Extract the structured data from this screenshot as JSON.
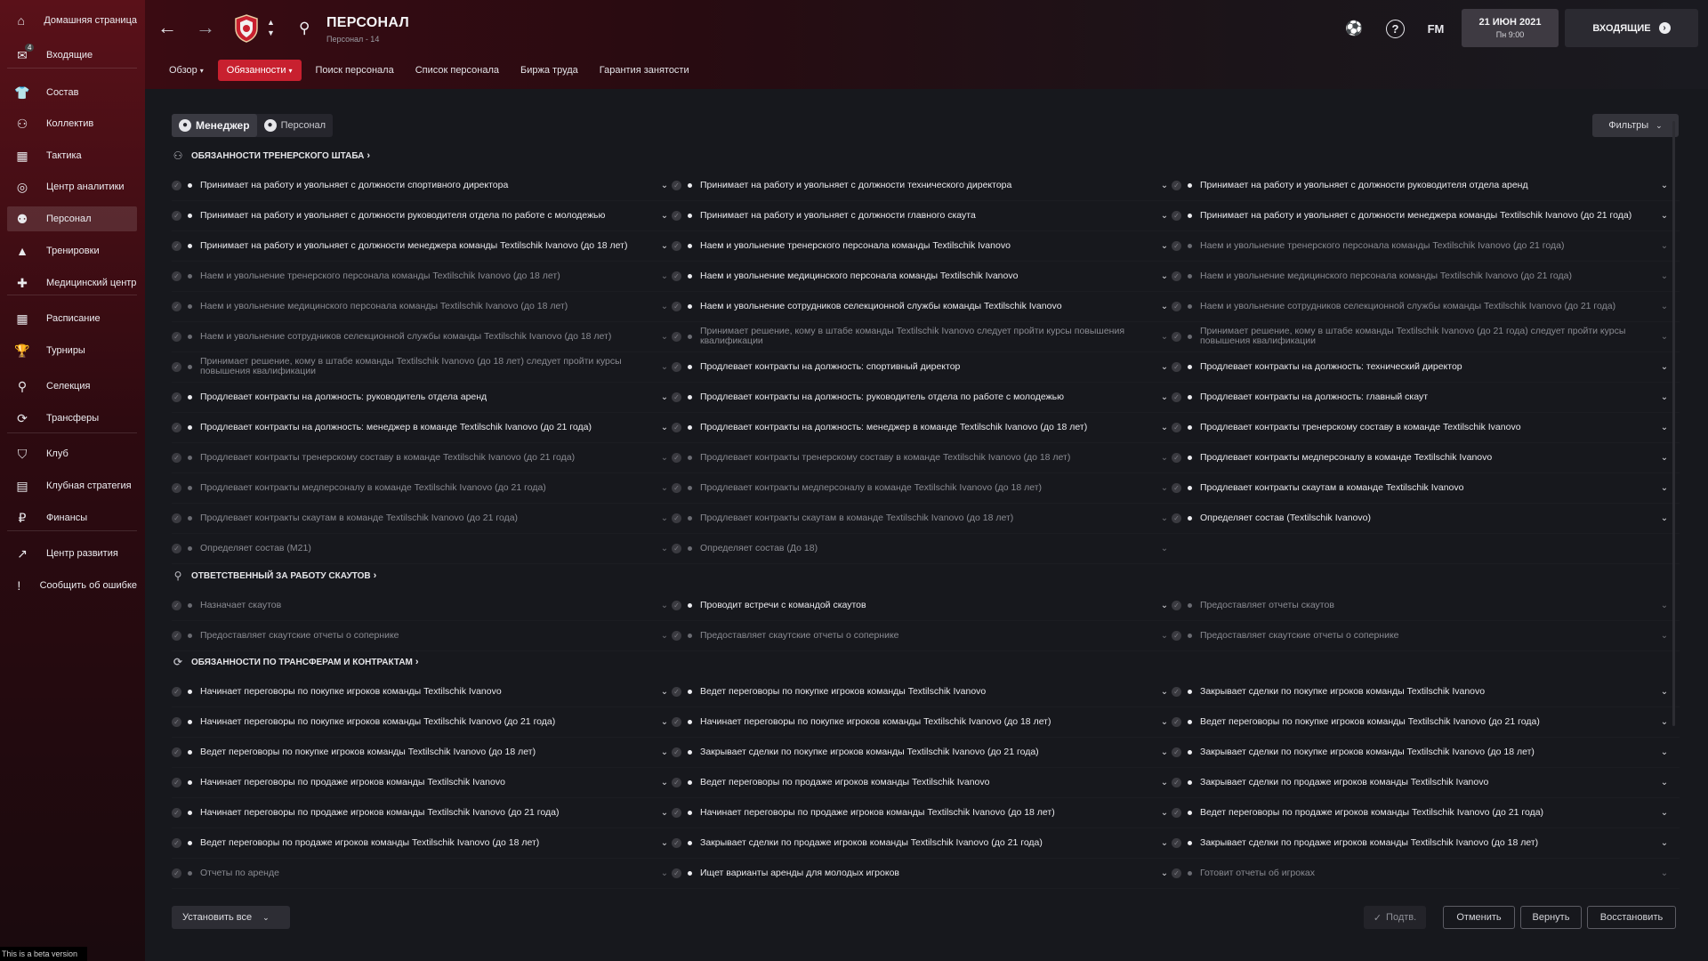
{
  "sidebar": {
    "inbox_badge": "4",
    "items": [
      {
        "label": "Домашняя страница",
        "icon": "home-icon"
      },
      {
        "label": "Входящие",
        "icon": "inbox-icon"
      },
      {
        "label": "Состав",
        "icon": "squad-icon"
      },
      {
        "label": "Коллектив",
        "icon": "dynamics-icon"
      },
      {
        "label": "Тактика",
        "icon": "tactics-icon"
      },
      {
        "label": "Центр аналитики",
        "icon": "analytics-icon"
      },
      {
        "label": "Персонал",
        "icon": "staff-icon"
      },
      {
        "label": "Тренировки",
        "icon": "training-icon"
      },
      {
        "label": "Медицинский центр",
        "icon": "medical-icon"
      },
      {
        "label": "Расписание",
        "icon": "calendar-icon"
      },
      {
        "label": "Турниры",
        "icon": "trophy-icon"
      },
      {
        "label": "Селекция",
        "icon": "scouting-icon"
      },
      {
        "label": "Трансферы",
        "icon": "transfers-icon"
      },
      {
        "label": "Клуб",
        "icon": "club-icon"
      },
      {
        "label": "Клубная стратегия",
        "icon": "strategy-icon"
      },
      {
        "label": "Финансы",
        "icon": "finances-icon"
      },
      {
        "label": "Центр развития",
        "icon": "development-icon"
      },
      {
        "label": "Сообщить об ошибке",
        "icon": "bug-report-icon"
      }
    ],
    "beta_label": "This is a beta version"
  },
  "header": {
    "title": "ПЕРСОНАЛ",
    "subtitle": "Персонал - 14",
    "tabs": [
      {
        "label": "Обзор",
        "dropdown": true
      },
      {
        "label": "Обязанности",
        "dropdown": true,
        "active": true
      },
      {
        "label": "Поиск персонала"
      },
      {
        "label": "Список персонала"
      },
      {
        "label": "Биржа труда"
      },
      {
        "label": "Гарантия занятости"
      }
    ],
    "fm_label": "FM",
    "help_label": "?",
    "date": "21 ИЮН 2021",
    "day_time": "Пн 9:00",
    "inbox_label": "ВХОДЯЩИЕ"
  },
  "toolbar": {
    "manager_label": "Менеджер",
    "staff_label": "Персонал",
    "filters_label": "Фильтры"
  },
  "sections": [
    {
      "title": "ОБЯЗАННОСТИ ТРЕНЕРСКОГО ШТАБА",
      "icon": "coaching-staff-icon",
      "rows": [
        [
          {
            "t": "Принимает на работу и увольняет с должности спортивного директора",
            "a": true
          },
          {
            "t": "Принимает на работу и увольняет с должности технического директора",
            "a": true
          },
          {
            "t": "Принимает на работу и увольняет с должности руководителя отдела аренд",
            "a": true
          }
        ],
        [
          {
            "t": "Принимает на работу и увольняет с должности руководителя отдела по работе с молодежью",
            "a": true
          },
          {
            "t": "Принимает на работу и увольняет с должности главного скаута",
            "a": true
          },
          {
            "t": "Принимает на работу и увольняет с должности менеджера команды Textilschik Ivanovo (до 21 года)",
            "a": true
          }
        ],
        [
          {
            "t": "Принимает на работу и увольняет с должности менеджера команды Textilschik Ivanovo (до 18 лет)",
            "a": true
          },
          {
            "t": "Наем и увольнение тренерского персонала команды Textilschik Ivanovo",
            "a": true
          },
          {
            "t": "Наем и увольнение тренерского персонала команды Textilschik Ivanovo (до 21 года)",
            "a": false
          }
        ],
        [
          {
            "t": "Наем и увольнение тренерского персонала команды Textilschik Ivanovo (до 18 лет)",
            "a": false
          },
          {
            "t": "Наем и увольнение медицинского персонала команды Textilschik Ivanovo",
            "a": true
          },
          {
            "t": "Наем и увольнение медицинского персонала команды Textilschik Ivanovo (до 21 года)",
            "a": false
          }
        ],
        [
          {
            "t": "Наем и увольнение медицинского персонала команды Textilschik Ivanovo (до 18 лет)",
            "a": false
          },
          {
            "t": "Наем и увольнение сотрудников селекционной службы команды Textilschik Ivanovo",
            "a": true
          },
          {
            "t": "Наем и увольнение сотрудников селекционной службы команды Textilschik Ivanovo (до 21 года)",
            "a": false
          }
        ],
        [
          {
            "t": "Наем и увольнение сотрудников селекционной службы команды Textilschik Ivanovo (до 18 лет)",
            "a": false
          },
          {
            "t": "Принимает решение, кому в штабе команды Textilschik Ivanovo следует пройти курсы повышения квалификации",
            "a": false
          },
          {
            "t": "Принимает решение, кому в штабе команды Textilschik Ivanovo (до 21 года) следует пройти курсы повышения квалификации",
            "a": false
          }
        ],
        [
          {
            "t": "Принимает решение, кому в штабе команды Textilschik Ivanovo (до 18 лет) следует пройти курсы повышения квалификации",
            "a": false
          },
          {
            "t": "Продлевает контракты на должность: спортивный директор",
            "a": true
          },
          {
            "t": "Продлевает контракты на должность: технический директор",
            "a": true
          }
        ],
        [
          {
            "t": "Продлевает контракты на должность: руководитель отдела аренд",
            "a": true
          },
          {
            "t": "Продлевает контракты на должность: руководитель отдела по работе с молодежью",
            "a": true
          },
          {
            "t": "Продлевает контракты на должность: главный скаут",
            "a": true
          }
        ],
        [
          {
            "t": "Продлевает контракты на должность: менеджер в команде Textilschik Ivanovo (до 21 года)",
            "a": true
          },
          {
            "t": "Продлевает контракты на должность: менеджер в команде Textilschik Ivanovo (до 18 лет)",
            "a": true
          },
          {
            "t": "Продлевает контракты тренерскому составу в команде Textilschik Ivanovo",
            "a": true
          }
        ],
        [
          {
            "t": "Продлевает контракты тренерскому составу в команде Textilschik Ivanovo (до 21 года)",
            "a": false
          },
          {
            "t": "Продлевает контракты тренерскому составу в команде Textilschik Ivanovo (до 18 лет)",
            "a": false
          },
          {
            "t": "Продлевает контракты медперсоналу в команде Textilschik Ivanovo",
            "a": true
          }
        ],
        [
          {
            "t": "Продлевает контракты медперсоналу в команде Textilschik Ivanovo (до 21 года)",
            "a": false
          },
          {
            "t": "Продлевает контракты медперсоналу в команде Textilschik Ivanovo (до 18 лет)",
            "a": false
          },
          {
            "t": "Продлевает контракты скаутам в команде Textilschik Ivanovo",
            "a": true
          }
        ],
        [
          {
            "t": "Продлевает контракты скаутам в команде Textilschik Ivanovo (до 21 года)",
            "a": false
          },
          {
            "t": "Продлевает контракты скаутам в команде Textilschik Ivanovo (до 18 лет)",
            "a": false
          },
          {
            "t": "Определяет состав (Textilschik Ivanovo)",
            "a": true
          }
        ],
        [
          {
            "t": "Определяет состав (M21)",
            "a": false
          },
          {
            "t": "Определяет состав (До 18)",
            "a": false
          },
          null
        ]
      ]
    },
    {
      "title": "ОТВЕТСТВЕННЫЙ ЗА РАБОТУ СКАУТОВ",
      "icon": "scout-search-icon",
      "rows": [
        [
          {
            "t": "Назначает скаутов",
            "a": false
          },
          {
            "t": "Проводит встречи с командой скаутов",
            "a": true
          },
          {
            "t": "Предоставляет отчеты скаутов",
            "a": false
          }
        ],
        [
          {
            "t": "Предоставляет скаутские отчеты о сопернике",
            "a": false
          },
          {
            "t": "Предоставляет скаутские отчеты о сопернике",
            "a": false
          },
          {
            "t": "Предоставляет скаутские отчеты о сопернике",
            "a": false
          }
        ]
      ]
    },
    {
      "title": "ОБЯЗАННОСТИ ПО ТРАНСФЕРАМ И КОНТРАКТАМ",
      "icon": "transfer-contract-icon",
      "rows": [
        [
          {
            "t": "Начинает переговоры по покупке игроков команды Textilschik Ivanovo",
            "a": true
          },
          {
            "t": "Ведет переговоры по покупке игроков команды Textilschik Ivanovo",
            "a": true
          },
          {
            "t": "Закрывает сделки по покупке игроков команды Textilschik Ivanovo",
            "a": true
          }
        ],
        [
          {
            "t": "Начинает переговоры по покупке игроков команды Textilschik Ivanovo (до 21 года)",
            "a": true
          },
          {
            "t": "Начинает переговоры по покупке игроков команды Textilschik Ivanovo (до 18 лет)",
            "a": true
          },
          {
            "t": "Ведет переговоры по покупке игроков команды Textilschik Ivanovo (до 21 года)",
            "a": true
          }
        ],
        [
          {
            "t": "Ведет переговоры по покупке игроков команды Textilschik Ivanovo (до 18 лет)",
            "a": true
          },
          {
            "t": "Закрывает сделки по покупке игроков команды Textilschik Ivanovo (до 21 года)",
            "a": true
          },
          {
            "t": "Закрывает сделки по покупке игроков команды Textilschik Ivanovo (до 18 лет)",
            "a": true
          }
        ],
        [
          {
            "t": "Начинает переговоры по продаже игроков команды Textilschik Ivanovo",
            "a": true
          },
          {
            "t": "Ведет переговоры по продаже игроков команды Textilschik Ivanovo",
            "a": true
          },
          {
            "t": "Закрывает сделки по продаже игроков команды Textilschik Ivanovo",
            "a": true
          }
        ],
        [
          {
            "t": "Начинает переговоры по продаже игроков команды Textilschik Ivanovo (до 21 года)",
            "a": true
          },
          {
            "t": "Начинает переговоры по продаже игроков команды Textilschik Ivanovo (до 18 лет)",
            "a": true
          },
          {
            "t": "Ведет переговоры по продаже игроков команды Textilschik Ivanovo (до 21 года)",
            "a": true
          }
        ],
        [
          {
            "t": "Ведет переговоры по продаже игроков команды Textilschik Ivanovo (до 18 лет)",
            "a": true
          },
          {
            "t": "Закрывает сделки по продаже игроков команды Textilschik Ivanovo (до 21 года)",
            "a": true
          },
          {
            "t": "Закрывает сделки по продаже игроков команды Textilschik Ivanovo (до 18 лет)",
            "a": true
          }
        ],
        [
          {
            "t": "Отчеты по аренде",
            "a": false
          },
          {
            "t": "Ищет варианты аренды для молодых игроков",
            "a": true
          },
          {
            "t": "Готовит отчеты об игроках",
            "a": false
          }
        ]
      ]
    }
  ],
  "footer": {
    "set_all_label": "Установить все",
    "confirm_label": "Подтв.",
    "cancel_label": "Отменить",
    "revert_label": "Вернуть",
    "restore_label": "Восстановить"
  },
  "colors": {
    "accent": "#c8202f",
    "sidebar_top": "#5a1119",
    "background": "#17181d"
  }
}
